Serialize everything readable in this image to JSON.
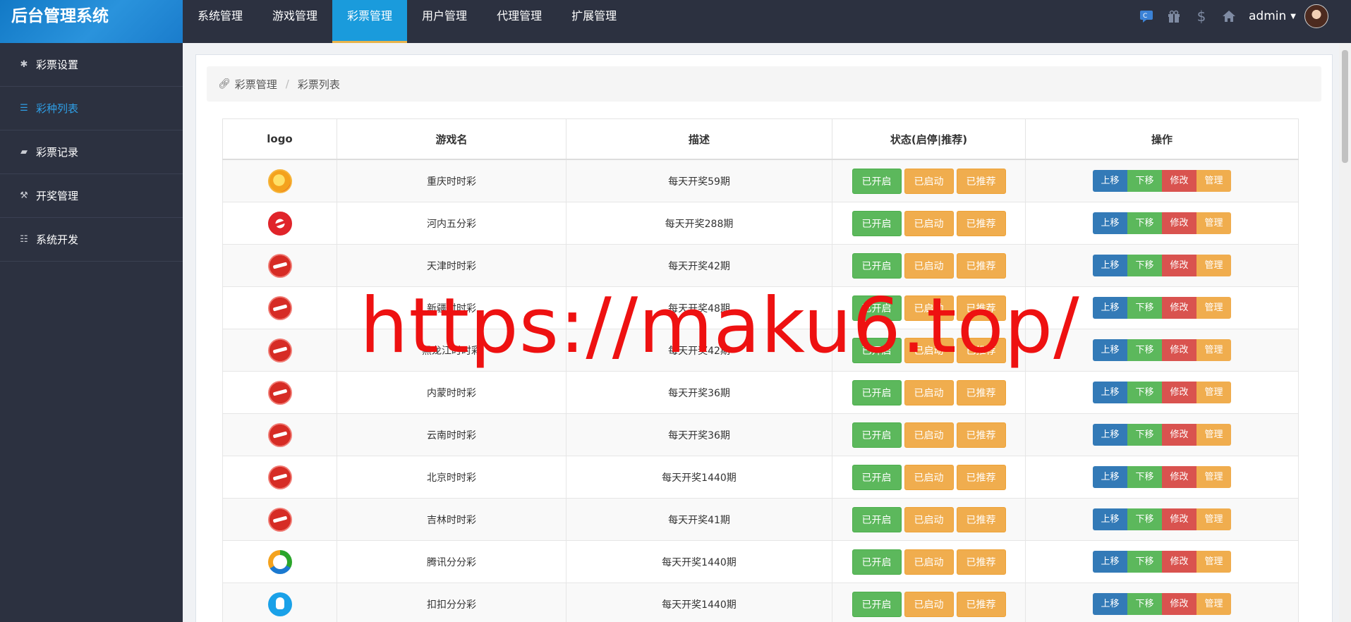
{
  "brand": {
    "title": "后台管理系统"
  },
  "nav": {
    "items": [
      {
        "label": "系统管理",
        "active": false
      },
      {
        "label": "游戏管理",
        "active": false
      },
      {
        "label": "彩票管理",
        "active": true
      },
      {
        "label": "用户管理",
        "active": false
      },
      {
        "label": "代理管理",
        "active": false
      },
      {
        "label": "扩展管理",
        "active": false
      }
    ]
  },
  "topbar": {
    "icons": [
      "chat-icon",
      "gift-icon",
      "dollar-icon",
      "home-icon"
    ],
    "user": "admin"
  },
  "sidebar": {
    "items": [
      {
        "label": "彩票设置",
        "icon": "gear-icon",
        "glyph": "✱",
        "active": false
      },
      {
        "label": "彩种列表",
        "icon": "list-icon",
        "glyph": "☰",
        "active": true
      },
      {
        "label": "彩票记录",
        "icon": "book-icon",
        "glyph": "▰",
        "active": false
      },
      {
        "label": "开奖管理",
        "icon": "gavel-icon",
        "glyph": "⚒",
        "active": false
      },
      {
        "label": "系统开发",
        "icon": "server-icon",
        "glyph": "☷",
        "active": false
      }
    ]
  },
  "breadcrumb": {
    "parent": "彩票管理",
    "separator": "/",
    "current": "彩票列表"
  },
  "table": {
    "headers": [
      "logo",
      "游戏名",
      "描述",
      "状态(启停|推荐)",
      "操作"
    ],
    "status_buttons": [
      "已开启",
      "已启动",
      "已推荐"
    ],
    "ops": [
      "上移",
      "下移",
      "修改",
      "管理"
    ],
    "rows": [
      {
        "logo": "orange",
        "name": "重庆时时彩",
        "desc": "每天开奖59期"
      },
      {
        "logo": "red",
        "name": "河内五分彩",
        "desc": "每天开奖288期"
      },
      {
        "logo": "fire",
        "name": "天津时时彩",
        "desc": "每天开奖42期"
      },
      {
        "logo": "fire",
        "name": "新疆时时彩",
        "desc": "每天开奖48期"
      },
      {
        "logo": "fire",
        "name": "黑龙江时时彩",
        "desc": "每天开奖42期"
      },
      {
        "logo": "fire",
        "name": "内蒙时时彩",
        "desc": "每天开奖36期"
      },
      {
        "logo": "fire",
        "name": "云南时时彩",
        "desc": "每天开奖36期"
      },
      {
        "logo": "fire",
        "name": "北京时时彩",
        "desc": "每天开奖1440期"
      },
      {
        "logo": "fire",
        "name": "吉林时时彩",
        "desc": "每天开奖41期"
      },
      {
        "logo": "tencent",
        "name": "腾讯分分彩",
        "desc": "每天开奖1440期"
      },
      {
        "logo": "qq",
        "name": "扣扣分分彩",
        "desc": "每天开奖1440期"
      }
    ]
  },
  "watermark": "https://maku6.top/"
}
